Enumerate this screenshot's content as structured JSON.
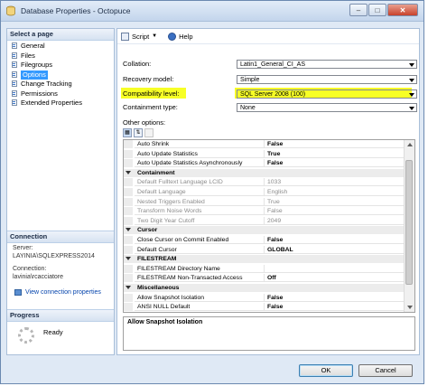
{
  "window": {
    "title": "Database Properties - Octopuce"
  },
  "sidebar": {
    "header": "Select a page",
    "pages": [
      {
        "label": "General"
      },
      {
        "label": "Files"
      },
      {
        "label": "Filegroups"
      },
      {
        "label": "Options",
        "selected": true
      },
      {
        "label": "Change Tracking"
      },
      {
        "label": "Permissions"
      },
      {
        "label": "Extended Properties"
      }
    ],
    "connection": {
      "header": "Connection",
      "server_label": "Server:",
      "server_value": "LAYINIA\\SQLEXPRESS2014",
      "connection_label": "Connection:",
      "connection_value": "lavinia\\rcacciatore",
      "link_label": "View connection properties"
    },
    "progress": {
      "header": "Progress",
      "status": "Ready"
    }
  },
  "toolbar": {
    "script_label": "Script",
    "help_label": "Help"
  },
  "form": {
    "collation": {
      "label": "Collation:",
      "value": "Latin1_General_CI_AS"
    },
    "recovery_model": {
      "label": "Recovery model:",
      "value": "Simple"
    },
    "compatibility_level": {
      "label": "Compatibility level:",
      "value": "SQL Server 2008 (100)"
    },
    "containment_type": {
      "label": "Containment type:",
      "value": "None"
    },
    "other_options_label": "Other options:"
  },
  "grid_rows": [
    {
      "kind": "prop",
      "name": "Auto Shrink",
      "value": "False"
    },
    {
      "kind": "prop",
      "name": "Auto Update Statistics",
      "value": "True"
    },
    {
      "kind": "prop",
      "name": "Auto Update Statistics Asynchronously",
      "value": "False"
    },
    {
      "kind": "cat",
      "name": "Containment"
    },
    {
      "kind": "prop",
      "name": "Default Fulltext Language LCID",
      "value": "1033",
      "disabled": true
    },
    {
      "kind": "prop",
      "name": "Default Language",
      "value": "English",
      "disabled": true
    },
    {
      "kind": "prop",
      "name": "Nested Triggers Enabled",
      "value": "True",
      "disabled": true
    },
    {
      "kind": "prop",
      "name": "Transform Noise Words",
      "value": "False",
      "disabled": true
    },
    {
      "kind": "prop",
      "name": "Two Digit Year Cutoff",
      "value": "2049",
      "disabled": true
    },
    {
      "kind": "cat",
      "name": "Cursor"
    },
    {
      "kind": "prop",
      "name": "Close Cursor on Commit Enabled",
      "value": "False"
    },
    {
      "kind": "prop",
      "name": "Default Cursor",
      "value": "GLOBAL"
    },
    {
      "kind": "cat",
      "name": "FILESTREAM"
    },
    {
      "kind": "prop",
      "name": "FILESTREAM Directory Name",
      "value": ""
    },
    {
      "kind": "prop",
      "name": "FILESTREAM Non-Transacted Access",
      "value": "Off"
    },
    {
      "kind": "cat",
      "name": "Miscellaneous"
    },
    {
      "kind": "prop",
      "name": "Allow Snapshot Isolation",
      "value": "False"
    },
    {
      "kind": "prop",
      "name": "ANSI NULL Default",
      "value": "False"
    }
  ],
  "description": {
    "text": "Allow Snapshot Isolation"
  },
  "buttons": {
    "ok_label": "OK",
    "cancel_label": "Cancel"
  },
  "colors": {
    "highlight": "#f6ff00",
    "selection": "#3399ff",
    "title_bar": "#c3d5ec"
  }
}
